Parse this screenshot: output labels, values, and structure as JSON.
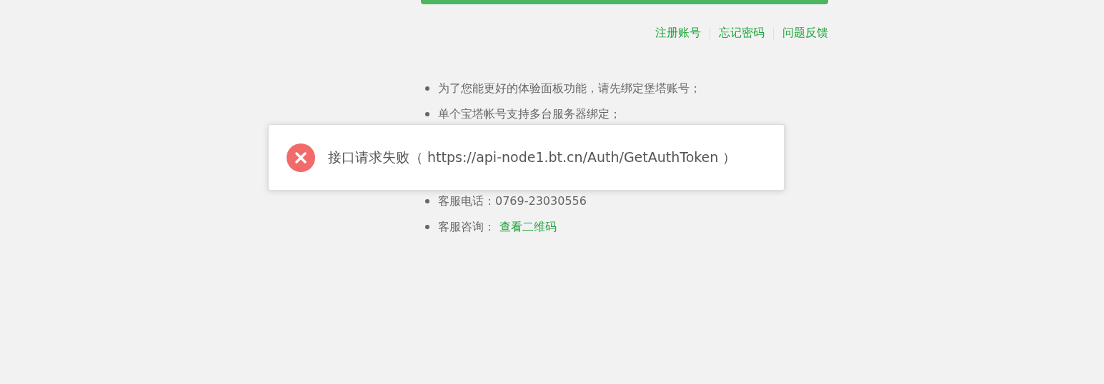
{
  "links": [
    "注册账号",
    "忘记密码",
    "问题反馈"
  ],
  "notes": [
    {
      "kind": "text",
      "text": "为了您能更好的体验面板功能，请先绑定堡塔账号；"
    },
    {
      "kind": "text",
      "text": "单个宝塔帐号支持多台服务器绑定；"
    },
    {
      "kind": "text",
      "text": "客服电话：0769-23030556"
    },
    {
      "kind": "link",
      "text": "客服咨询：",
      "link": "查看二维码"
    }
  ],
  "toast": {
    "kind": "error",
    "message": "接口请求失败（ https://api-node1.bt.cn/Auth/GetAuthToken ）"
  }
}
